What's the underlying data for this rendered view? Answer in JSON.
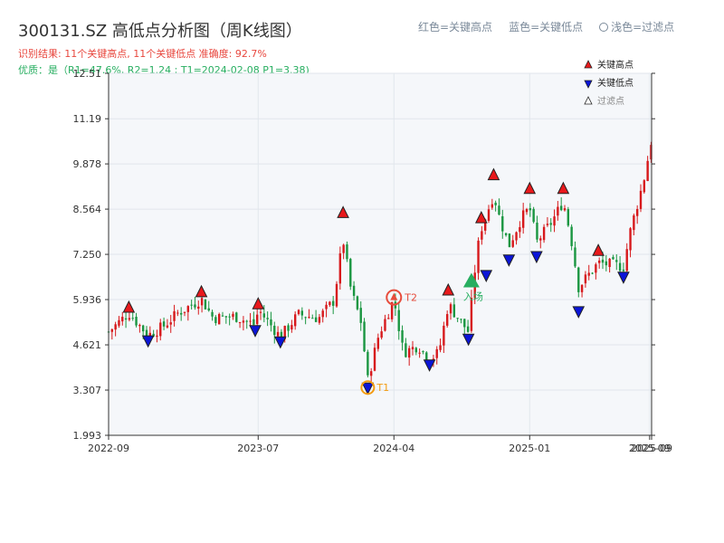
{
  "header": {
    "title": "300131.SZ 高低点分析图（周K线图）",
    "result": "识别结果: 11个关键高点, 11个关键低点   准确度: 92.7%",
    "quality": "优质：是（R1=47.6%, R2=1.24 ; T1=2024-02-08 P1=3.38)",
    "legend_red": "红色=关键高点",
    "legend_blue": "蓝色=关键低点",
    "legend_light": "浅色=过滤点"
  },
  "colors": {
    "up": "#d7191c",
    "down": "#1a9641",
    "high_marker": "#e8191c",
    "low_marker": "#0b15d8",
    "t_marker": "#f39c12",
    "t2_marker": "#e74c3c",
    "entry": "#27ae60",
    "plot_bg": "#f5f7fa",
    "grid": "#e1e6ec"
  },
  "chart_data": {
    "type": "candlestick",
    "title": "300131.SZ 高低点分析图（周K线图）",
    "ylim": [
      1.993,
      12.51
    ],
    "yticks": [
      "1.993",
      "3.307",
      "4.621",
      "5.936",
      "7.250",
      "8.564",
      "9.878",
      "11.19",
      "12.51"
    ],
    "ytick_values": [
      1.993,
      3.307,
      4.621,
      5.936,
      7.25,
      8.564,
      9.878,
      11.19,
      12.51
    ],
    "x_start": "2022-09-01",
    "x_end": "2025-09-05",
    "xticks": [
      {
        "label": "2022-09",
        "date": "2022-09-01"
      },
      {
        "label": "2023-07",
        "date": "2023-07-01"
      },
      {
        "label": "2024-04",
        "date": "2024-04-01"
      },
      {
        "label": "2025-01",
        "date": "2025-01-01"
      },
      {
        "label": "2025-09",
        "date": "2025-09-01"
      },
      {
        "label": "2025-09",
        "date": "2025-09-05"
      }
    ],
    "key_points": [
      {
        "kind": "high",
        "date": "2022-10-12",
        "value": 5.7
      },
      {
        "kind": "high",
        "date": "2023-03-08",
        "value": 6.15
      },
      {
        "kind": "high",
        "date": "2023-07-01",
        "value": 5.8
      },
      {
        "kind": "high",
        "date": "2023-12-20",
        "value": 8.45
      },
      {
        "kind": "high",
        "date": "2024-07-20",
        "value": 6.2
      },
      {
        "kind": "high",
        "date": "2024-09-25",
        "value": 8.3
      },
      {
        "kind": "high",
        "date": "2024-10-20",
        "value": 9.55
      },
      {
        "kind": "high",
        "date": "2025-01-01",
        "value": 9.15
      },
      {
        "kind": "high",
        "date": "2025-03-10",
        "value": 9.15
      },
      {
        "kind": "high",
        "date": "2025-05-20",
        "value": 7.35
      },
      {
        "kind": "low",
        "date": "2022-11-20",
        "value": 4.75
      },
      {
        "kind": "low",
        "date": "2023-06-25",
        "value": 5.05
      },
      {
        "kind": "low",
        "date": "2023-08-15",
        "value": 4.72
      },
      {
        "kind": "low",
        "date": "2024-02-08",
        "value": 3.38
      },
      {
        "kind": "low",
        "date": "2024-06-12",
        "value": 4.05
      },
      {
        "kind": "low",
        "date": "2024-08-30",
        "value": 4.8
      },
      {
        "kind": "low",
        "date": "2024-10-05",
        "value": 6.65
      },
      {
        "kind": "low",
        "date": "2024-11-20",
        "value": 7.1
      },
      {
        "kind": "low",
        "date": "2025-01-15",
        "value": 7.2
      },
      {
        "kind": "low",
        "date": "2025-04-10",
        "value": 5.6
      },
      {
        "kind": "low",
        "date": "2025-07-10",
        "value": 6.6
      }
    ],
    "annotations": [
      {
        "label": "T1",
        "date": "2024-02-08",
        "value": 3.38,
        "kind": "t1"
      },
      {
        "label": "T2",
        "date": "2024-04-01",
        "value": 6.0,
        "kind": "t2"
      },
      {
        "label": "入场",
        "date": "2024-09-05",
        "value": 6.45,
        "kind": "entry"
      }
    ],
    "legend": [
      {
        "label": "关键高点",
        "marker": "high"
      },
      {
        "label": "关键低点",
        "marker": "low"
      },
      {
        "label": "过滤点",
        "marker": "filtered"
      }
    ],
    "path_anchors": [
      [
        "2022-09-01",
        5.0
      ],
      [
        "2022-10-12",
        5.55
      ],
      [
        "2022-11-20",
        4.9
      ],
      [
        "2022-12-20",
        5.15
      ],
      [
        "2023-01-20",
        5.55
      ],
      [
        "2023-03-08",
        5.95
      ],
      [
        "2023-04-01",
        5.4
      ],
      [
        "2023-05-15",
        5.45
      ],
      [
        "2023-06-25",
        5.2
      ],
      [
        "2023-07-01",
        5.65
      ],
      [
        "2023-08-15",
        4.85
      ],
      [
        "2023-09-20",
        5.5
      ],
      [
        "2023-11-01",
        5.4
      ],
      [
        "2023-12-01",
        5.9
      ],
      [
        "2023-12-20",
        7.7
      ],
      [
        "2024-01-05",
        6.2
      ],
      [
        "2024-01-25",
        5.3
      ],
      [
        "2024-02-08",
        3.6
      ],
      [
        "2024-03-01",
        4.9
      ],
      [
        "2024-04-01",
        5.95
      ],
      [
        "2024-04-20",
        4.4
      ],
      [
        "2024-05-20",
        4.6
      ],
      [
        "2024-06-12",
        4.2
      ],
      [
        "2024-07-01",
        4.4
      ],
      [
        "2024-07-20",
        5.8
      ],
      [
        "2024-08-30",
        5.0
      ],
      [
        "2024-09-15",
        7.2
      ],
      [
        "2024-09-25",
        8.0
      ],
      [
        "2024-10-20",
        9.0
      ],
      [
        "2024-11-01",
        8.3
      ],
      [
        "2024-11-20",
        7.5
      ],
      [
        "2024-12-15",
        8.3
      ],
      [
        "2025-01-01",
        8.6
      ],
      [
        "2025-01-15",
        7.6
      ],
      [
        "2025-02-15",
        8.2
      ],
      [
        "2025-03-10",
        8.8
      ],
      [
        "2025-03-25",
        7.8
      ],
      [
        "2025-04-10",
        6.3
      ],
      [
        "2025-05-20",
        7.0
      ],
      [
        "2025-07-10",
        6.9
      ],
      [
        "2025-07-25",
        8.0
      ],
      [
        "2025-08-20",
        9.4
      ],
      [
        "2025-09-05",
        10.6
      ]
    ]
  }
}
